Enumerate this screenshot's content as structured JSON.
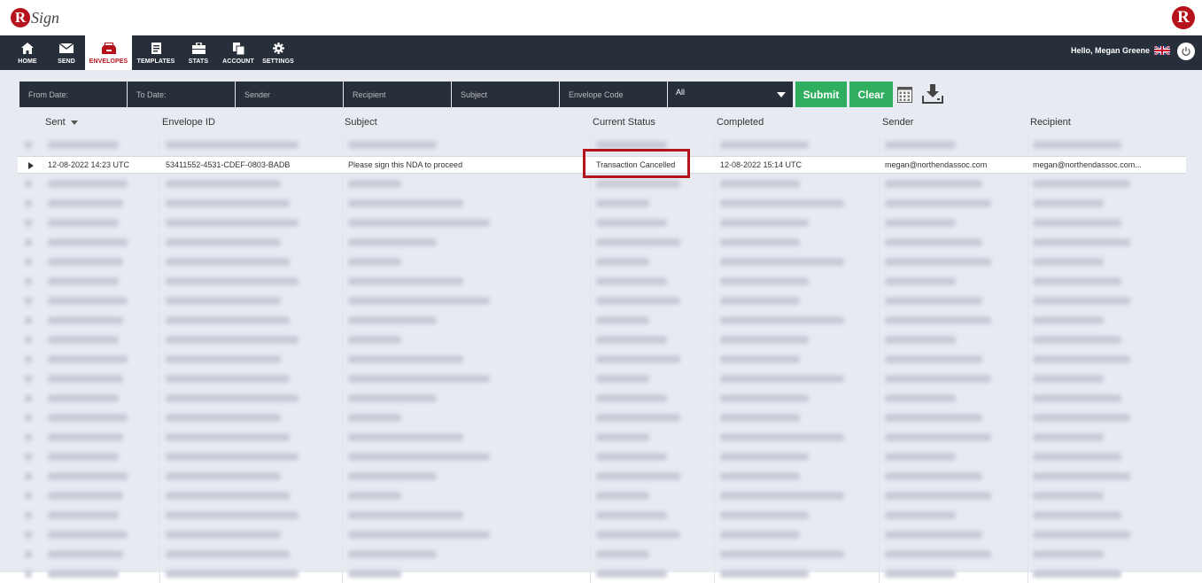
{
  "header": {
    "logo_text": "Sign",
    "greeting": "Hello, Megan Greene"
  },
  "nav": [
    {
      "label": "HOME",
      "icon": "home-icon"
    },
    {
      "label": "SEND",
      "icon": "envelope-icon"
    },
    {
      "label": "ENVELOPES",
      "icon": "open-box-icon",
      "active": true
    },
    {
      "label": "TEMPLATES",
      "icon": "template-icon"
    },
    {
      "label": "STATS",
      "icon": "briefcase-icon"
    },
    {
      "label": "ACCOUNT",
      "icon": "documents-icon"
    },
    {
      "label": "SETTINGS",
      "icon": "gear-icon"
    }
  ],
  "filters": {
    "from_date": "From Date:",
    "to_date": "To Date:",
    "sender": "Sender",
    "recipient": "Recipient",
    "subject": "Subject",
    "envelope_code": "Envelope Code",
    "status_selected": "All",
    "submit": "Submit",
    "clear": "Clear"
  },
  "table": {
    "headers": [
      "Sent",
      "Envelope ID",
      "Subject",
      "Current Status",
      "Completed",
      "Sender",
      "Recipient"
    ],
    "sort_column": "Sent",
    "selected_row": {
      "sent": "12-08-2022 14:23 UTC",
      "envelope_id": "53411552-4531-CDEF-0803-BADB",
      "subject": "Please sign this NDA to proceed",
      "status": "Transaction Cancelled",
      "completed": "12-08-2022 15:14 UTC",
      "sender": "megan@northendassoc.com",
      "recipient": "megan@northendassoc.com..."
    }
  },
  "colors": {
    "brand_red": "#b5121b",
    "nav_dark": "#272f3a",
    "button_green": "#2fae5f",
    "highlight_red": "#b3141c"
  }
}
